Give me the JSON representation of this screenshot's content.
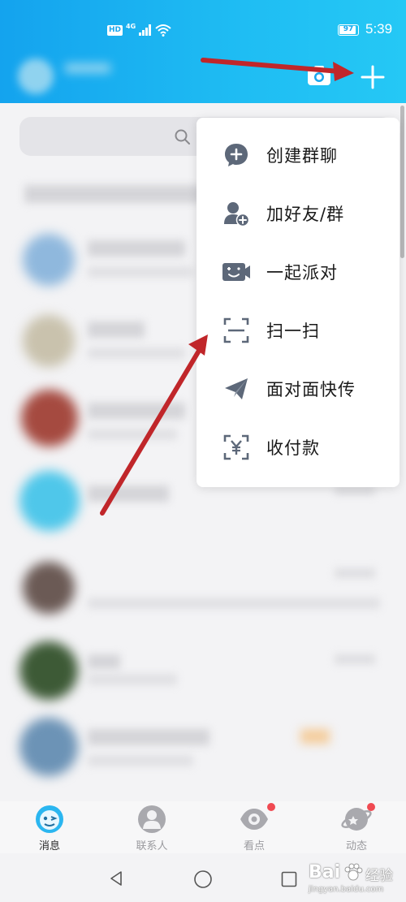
{
  "status_bar": {
    "network_hd": "HD",
    "network_type": "4G",
    "battery_level": "97",
    "time": "5:39"
  },
  "header": {
    "camera_icon": "camera-icon",
    "plus_icon": "plus-icon"
  },
  "popup_menu": {
    "items": [
      {
        "label": "创建群聊",
        "icon": "create-group-icon"
      },
      {
        "label": "加好友/群",
        "icon": "add-friend-icon"
      },
      {
        "label": "一起派对",
        "icon": "party-icon"
      },
      {
        "label": "扫一扫",
        "icon": "scan-icon"
      },
      {
        "label": "面对面快传",
        "icon": "send-plane-icon"
      },
      {
        "label": "收付款",
        "icon": "payment-icon"
      }
    ]
  },
  "tab_bar": {
    "tabs": [
      {
        "label": "消息",
        "icon": "message-icon",
        "active": true
      },
      {
        "label": "联系人",
        "icon": "contacts-icon",
        "active": false
      },
      {
        "label": "看点",
        "icon": "eye-icon",
        "active": false,
        "badge": true
      },
      {
        "label": "动态",
        "icon": "planet-icon",
        "active": false,
        "badge": true
      }
    ]
  },
  "watermark": {
    "brand": "Bai",
    "brand_suffix": "经验",
    "url": "jingyan.baidu.com"
  },
  "colors": {
    "header_blue": "#1aa7ee",
    "accent_red": "#c0262a",
    "icon_grey": "#5d6879"
  }
}
